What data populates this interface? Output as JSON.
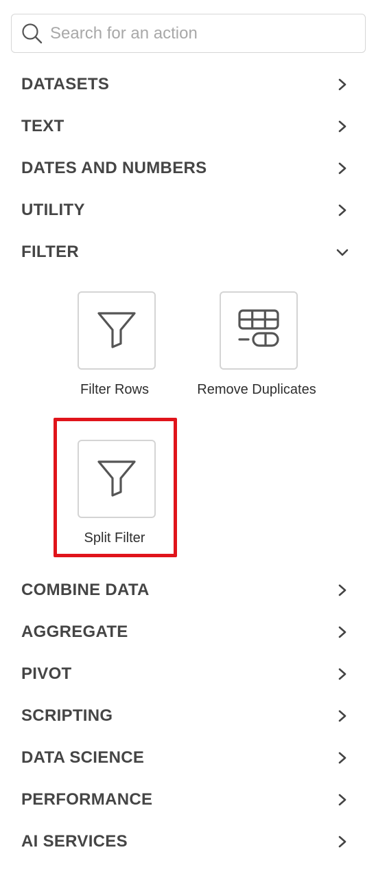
{
  "search": {
    "placeholder": "Search for an action",
    "icon": "search-icon"
  },
  "categories_top": [
    {
      "label": "DATASETS",
      "state": "collapsed"
    },
    {
      "label": "TEXT",
      "state": "collapsed"
    },
    {
      "label": "DATES AND NUMBERS",
      "state": "collapsed"
    },
    {
      "label": "UTILITY",
      "state": "collapsed"
    },
    {
      "label": "FILTER",
      "state": "expanded"
    }
  ],
  "filter_actions": [
    {
      "label": "Filter Rows",
      "icon": "funnel-icon"
    },
    {
      "label": "Remove Duplicates",
      "icon": "remove-duplicates-icon"
    },
    {
      "label": "Split Filter",
      "icon": "funnel-icon",
      "highlighted": true
    }
  ],
  "categories_bottom": [
    {
      "label": "COMBINE DATA",
      "state": "collapsed"
    },
    {
      "label": "AGGREGATE",
      "state": "collapsed"
    },
    {
      "label": "PIVOT",
      "state": "collapsed"
    },
    {
      "label": "SCRIPTING",
      "state": "collapsed"
    },
    {
      "label": "DATA SCIENCE",
      "state": "collapsed"
    },
    {
      "label": "PERFORMANCE",
      "state": "collapsed"
    },
    {
      "label": "AI SERVICES",
      "state": "collapsed"
    }
  ],
  "colors": {
    "highlight": "#e0141b",
    "text": "#454545",
    "border": "#d4d4d4"
  }
}
